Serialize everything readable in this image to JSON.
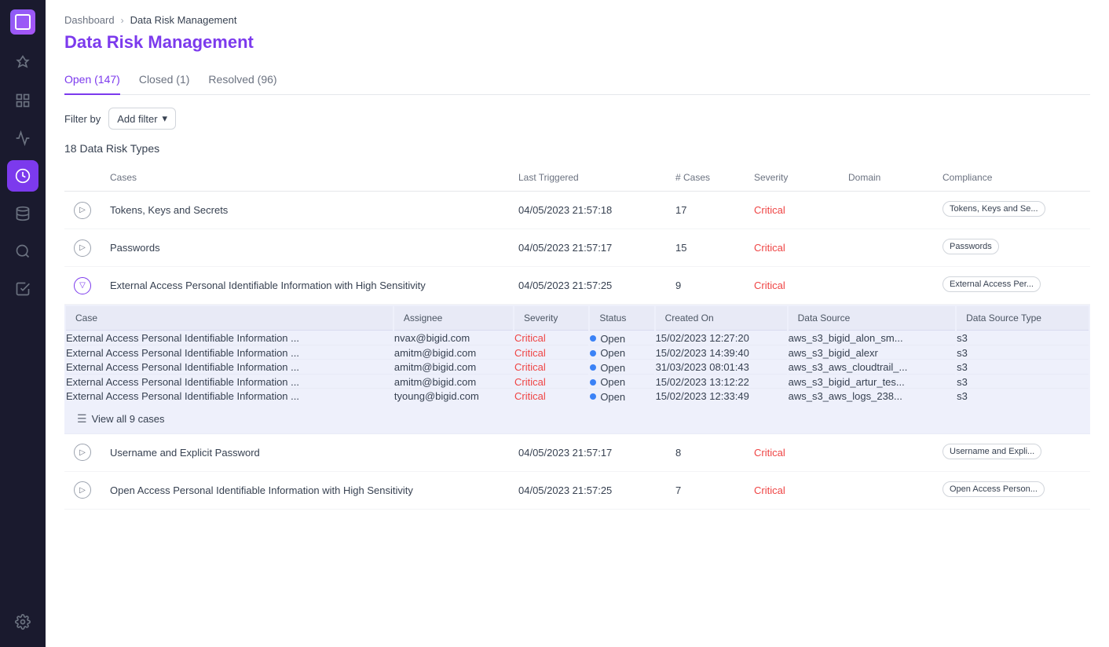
{
  "sidebar": {
    "items": [
      {
        "name": "rocket-icon",
        "label": "Launch",
        "icon": "🚀",
        "active": false
      },
      {
        "name": "dashboard-icon",
        "label": "Dashboard",
        "icon": "⊞",
        "active": false
      },
      {
        "name": "chart-icon",
        "label": "Analytics",
        "icon": "📊",
        "active": false
      },
      {
        "name": "risk-icon",
        "label": "Data Risk",
        "icon": "⚡",
        "active": true
      },
      {
        "name": "data-icon",
        "label": "Data",
        "icon": "🗄",
        "active": false
      },
      {
        "name": "discovery-icon",
        "label": "Discovery",
        "icon": "🔍",
        "active": false
      },
      {
        "name": "tasks-icon",
        "label": "Tasks",
        "icon": "☑",
        "active": false
      },
      {
        "name": "settings-icon",
        "label": "Settings",
        "icon": "⚙",
        "active": false
      }
    ]
  },
  "breadcrumb": {
    "link_label": "Dashboard",
    "current_label": "Data Risk Management"
  },
  "page_title": "Data Risk Management",
  "tabs": [
    {
      "id": "open",
      "label": "Open (147)",
      "active": true
    },
    {
      "id": "closed",
      "label": "Closed (1)",
      "active": false
    },
    {
      "id": "resolved",
      "label": "Resolved (96)",
      "active": false
    }
  ],
  "filter": {
    "label": "Filter by",
    "button_label": "Add filter"
  },
  "section_title": "18 Data Risk Types",
  "table": {
    "headers": {
      "cases": "Cases",
      "last_triggered": "Last Triggered",
      "num_cases": "# Cases",
      "severity": "Severity",
      "domain": "Domain",
      "compliance": "Compliance"
    },
    "rows": [
      {
        "id": "row1",
        "case_name": "Tokens, Keys and Secrets",
        "last_triggered": "04/05/2023 21:57:18",
        "num_cases": 17,
        "severity": "Critical",
        "domain": "",
        "compliance": "Tokens, Keys and Se...",
        "expanded": false
      },
      {
        "id": "row2",
        "case_name": "Passwords",
        "last_triggered": "04/05/2023 21:57:17",
        "num_cases": 15,
        "severity": "Critical",
        "domain": "",
        "compliance": "Passwords",
        "expanded": false
      },
      {
        "id": "row3",
        "case_name": "External Access Personal Identifiable Information with High Sensitivity",
        "last_triggered": "04/05/2023 21:57:25",
        "num_cases": 9,
        "severity": "Critical",
        "domain": "",
        "compliance": "External Access Per...",
        "expanded": true,
        "sub_cases": [
          {
            "case": "External Access Personal Identifiable Information ...",
            "assignee": "nvax@bigid.com",
            "severity": "Critical",
            "status": "Open",
            "created_on": "15/02/2023 12:27:20",
            "data_source": "aws_s3_bigid_alon_sm...",
            "data_source_type": "s3"
          },
          {
            "case": "External Access Personal Identifiable Information ...",
            "assignee": "amitm@bigid.com",
            "severity": "Critical",
            "status": "Open",
            "created_on": "15/02/2023 14:39:40",
            "data_source": "aws_s3_bigid_alexr",
            "data_source_type": "s3"
          },
          {
            "case": "External Access Personal Identifiable Information ...",
            "assignee": "amitm@bigid.com",
            "severity": "Critical",
            "status": "Open",
            "created_on": "31/03/2023 08:01:43",
            "data_source": "aws_s3_aws_cloudtrail_...",
            "data_source_type": "s3"
          },
          {
            "case": "External Access Personal Identifiable Information ...",
            "assignee": "amitm@bigid.com",
            "severity": "Critical",
            "status": "Open",
            "created_on": "15/02/2023 13:12:22",
            "data_source": "aws_s3_bigid_artur_tes...",
            "data_source_type": "s3"
          },
          {
            "case": "External Access Personal Identifiable Information ...",
            "assignee": "tyoung@bigid.com",
            "severity": "Critical",
            "status": "Open",
            "created_on": "15/02/2023 12:33:49",
            "data_source": "aws_s3_aws_logs_238...",
            "data_source_type": "s3"
          }
        ],
        "view_all_label": "View all 9 cases"
      },
      {
        "id": "row4",
        "case_name": "Username and Explicit Password",
        "last_triggered": "04/05/2023 21:57:17",
        "num_cases": 8,
        "severity": "Critical",
        "domain": "",
        "compliance": "Username and Expli...",
        "expanded": false
      },
      {
        "id": "row5",
        "case_name": "Open Access Personal Identifiable Information with High Sensitivity",
        "last_triggered": "04/05/2023 21:57:25",
        "num_cases": 7,
        "severity": "Critical",
        "domain": "",
        "compliance": "Open Access Person...",
        "expanded": false
      }
    ],
    "sub_headers": {
      "case": "Case",
      "assignee": "Assignee",
      "severity": "Severity",
      "status": "Status",
      "created_on": "Created On",
      "data_source": "Data Source",
      "data_source_type": "Data Source Type"
    }
  },
  "colors": {
    "critical": "#ef4444",
    "active_tab": "#7c3aed",
    "open_dot": "#3b82f6",
    "sub_bg": "#eef0fb",
    "sub_header_bg": "#e8eaf6"
  }
}
